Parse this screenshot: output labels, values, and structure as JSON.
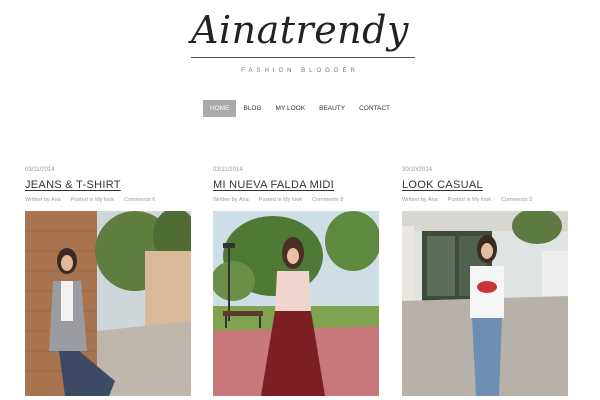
{
  "header": {
    "logo": "Ainatrendy",
    "tagline": "FASHION BLOGGER"
  },
  "nav": {
    "items": [
      {
        "label": "HOME",
        "active": true
      },
      {
        "label": "BLOG"
      },
      {
        "label": "MY LOOK"
      },
      {
        "label": "BEAUTY"
      },
      {
        "label": "CONTACT"
      }
    ]
  },
  "posts": [
    {
      "date": "03/11/2014",
      "title": "JEANS & T-SHIRT",
      "author": "Written by Ana",
      "category": "Posted in My look",
      "comments": "Comments 6"
    },
    {
      "date": "03/11/2014",
      "title": "MI NUEVA FALDA MIDI",
      "author": "Written by Ana",
      "category": "Posted in My look",
      "comments": "Comments 8"
    },
    {
      "date": "30/10/2014",
      "title": "LOOK CASUAL",
      "author": "Written by Ana",
      "category": "Posted in My look",
      "comments": "Comments 2"
    }
  ]
}
